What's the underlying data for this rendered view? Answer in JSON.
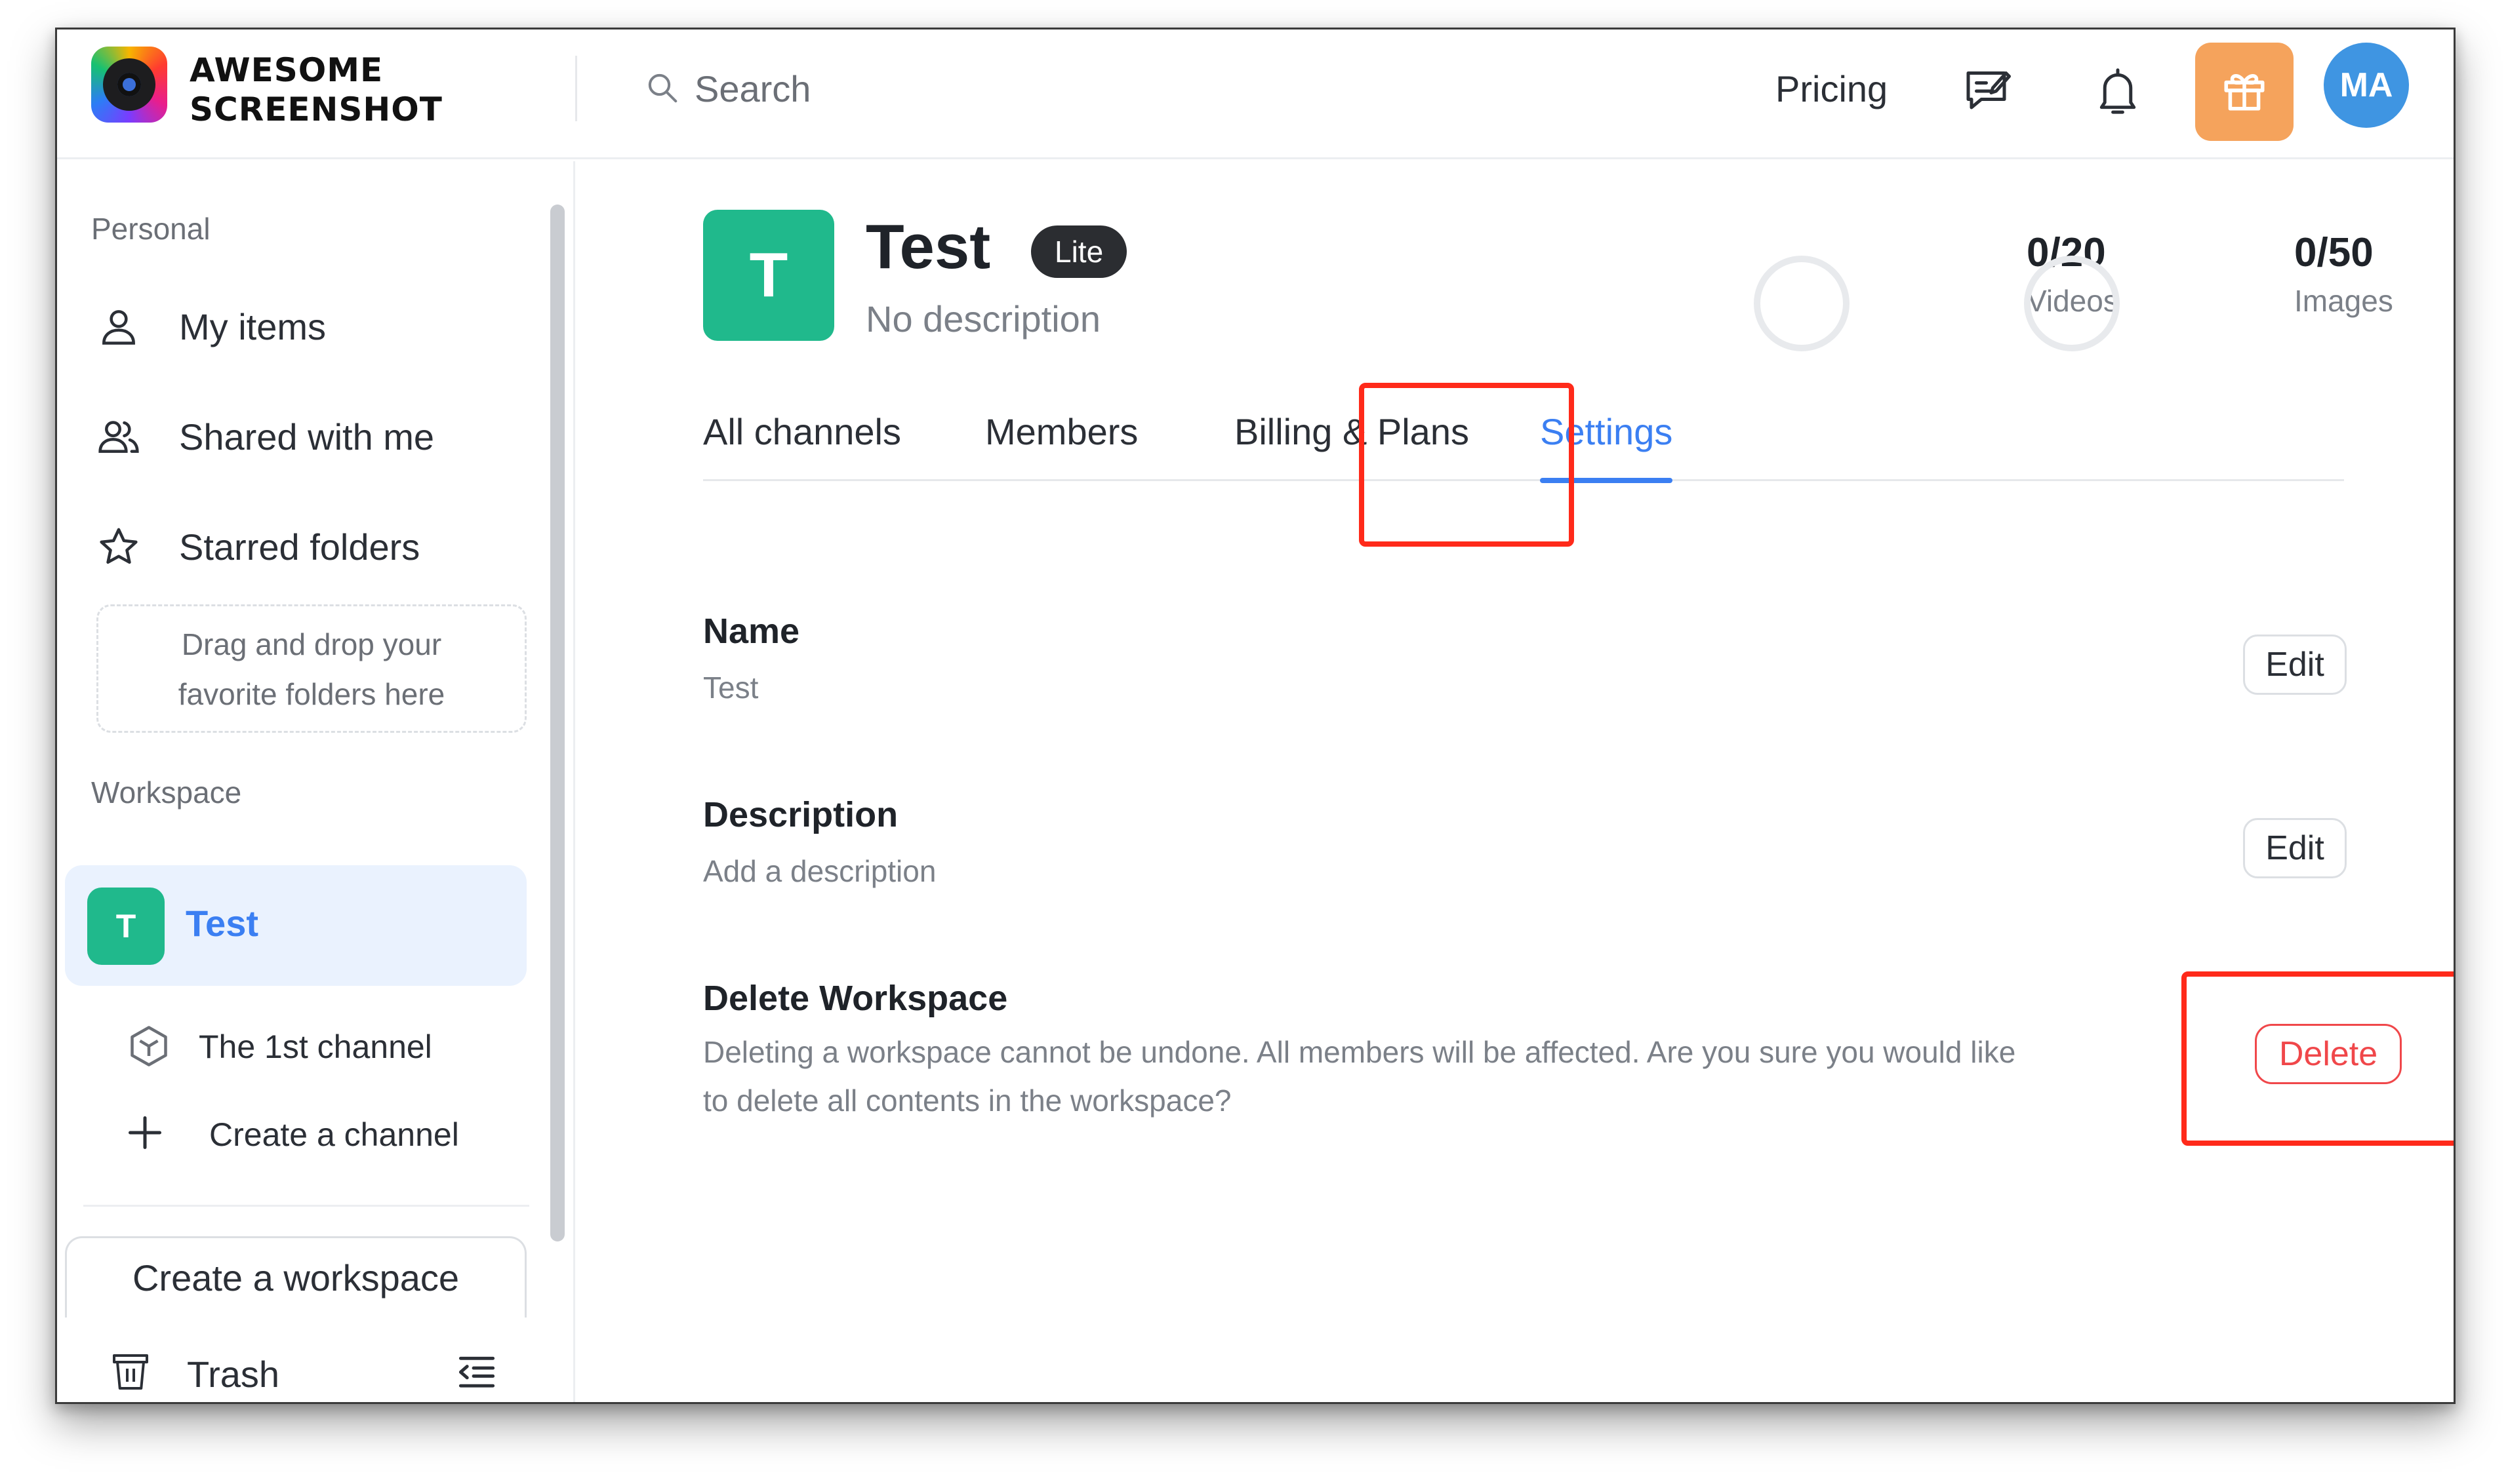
{
  "header": {
    "brand_line1": "AWESOME",
    "brand_line2": "SCREENSHOT",
    "search_placeholder": "Search",
    "pricing_label": "Pricing",
    "avatar_initials": "MA",
    "gift_color": "#f5a35c",
    "avatar_color": "#3f95e2"
  },
  "sidebar": {
    "personal_heading": "Personal",
    "items": [
      {
        "label": "My items",
        "icon": "user-icon"
      },
      {
        "label": "Shared with me",
        "icon": "users-icon"
      },
      {
        "label": "Starred folders",
        "icon": "star-icon"
      }
    ],
    "dropzone_line1": "Drag and drop your",
    "dropzone_line2": "favorite folders here",
    "workspace_heading": "Workspace",
    "workspace": {
      "initial": "T",
      "name": "Test",
      "color": "#20b98c"
    },
    "channel_label": "The 1st channel",
    "create_channel_label": "Create a channel",
    "create_workspace_label": "Create a workspace",
    "trash_label": "Trash"
  },
  "main": {
    "workspace_initial": "T",
    "workspace_title": "Test",
    "plan_badge": "Lite",
    "workspace_description": "No description",
    "stats": [
      {
        "value": "0/20",
        "label": "Videos"
      },
      {
        "value": "0/50",
        "label": "Images"
      }
    ],
    "tabs": [
      {
        "label": "All channels",
        "active": false
      },
      {
        "label": "Members",
        "active": false
      },
      {
        "label": "Billing & Plans",
        "active": false
      },
      {
        "label": "Settings",
        "active": true
      }
    ],
    "settings": {
      "name_title": "Name",
      "name_value": "Test",
      "description_title": "Description",
      "description_value": "Add a description",
      "delete_title": "Delete Workspace",
      "delete_text_line1": "Deleting a workspace cannot be undone. All members will be affected. Are you sure you would like",
      "delete_text_line2": "to delete all contents in the workspace?",
      "edit_label": "Edit",
      "delete_label": "Delete"
    },
    "accent_color": "#3b7ff2",
    "highlight_color": "#ff2a1a"
  }
}
